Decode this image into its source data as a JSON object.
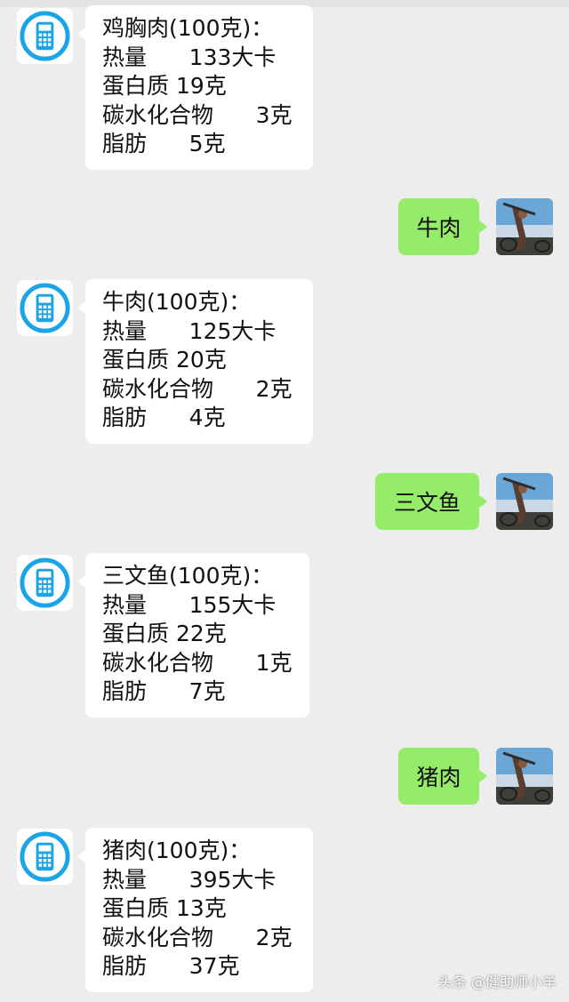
{
  "messages": [
    {
      "side": "left",
      "rows": [
        "鸡胸肉(100克)：",
        "热量      133大卡",
        "蛋白质 19克",
        "碳水化合物      3克",
        "脂肪      5克"
      ]
    },
    {
      "side": "right",
      "text": "牛肉"
    },
    {
      "side": "left",
      "rows": [
        "牛肉(100克)：",
        "热量      125大卡",
        "蛋白质 20克",
        "碳水化合物      2克",
        "脂肪      4克"
      ]
    },
    {
      "side": "right",
      "text": "三文鱼"
    },
    {
      "side": "left",
      "rows": [
        "三文鱼(100克)：",
        "热量      155大卡",
        "蛋白质 22克",
        "碳水化合物      1克",
        "脂肪      7克"
      ]
    },
    {
      "side": "right",
      "text": "猪肉"
    },
    {
      "side": "left",
      "rows": [
        "猪肉(100克)：",
        "热量      395大卡",
        "蛋白质 13克",
        "碳水化合物      2克",
        "脂肪      37克"
      ]
    }
  ],
  "watermark": "头条 @健助师小羊",
  "icons": {
    "bot": "calculator-icon",
    "user": "user-photo-avatar"
  },
  "colors": {
    "background": "#ededed",
    "sent_bubble": "#95ec69",
    "received_bubble": "#ffffff",
    "calculator_blue": "#1aa5e8"
  }
}
